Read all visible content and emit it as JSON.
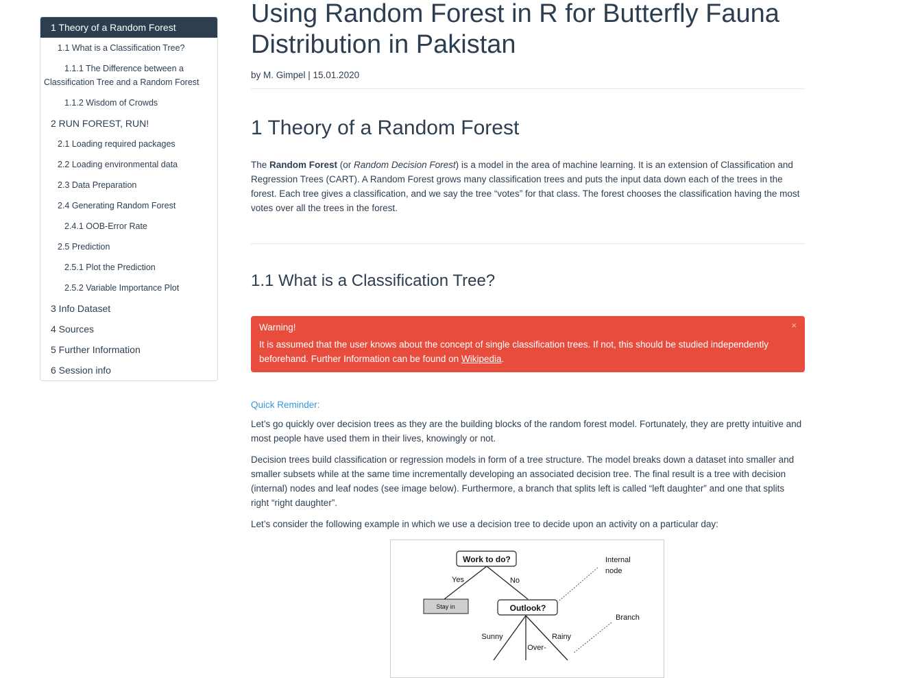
{
  "toc": [
    {
      "label": "1 Theory of a Random Forest",
      "level": 1,
      "active": true
    },
    {
      "label": "1.1 What is a Classification Tree?",
      "level": 2
    },
    {
      "label": "1.1.1 The Difference between a Classification Tree and a Random Forest",
      "level": 3
    },
    {
      "label": "1.1.2 Wisdom of Crowds",
      "level": 3
    },
    {
      "label": "2 RUN FOREST, RUN!",
      "level": 1
    },
    {
      "label": "2.1 Loading required packages",
      "level": 2
    },
    {
      "label": "2.2 Loading environmental data",
      "level": 2
    },
    {
      "label": "2.3 Data Preparation",
      "level": 2
    },
    {
      "label": "2.4 Generating Random Forest",
      "level": 2
    },
    {
      "label": "2.4.1 OOB-Error Rate",
      "level": 3
    },
    {
      "label": "2.5 Prediction",
      "level": 2
    },
    {
      "label": "2.5.1 Plot the Prediction",
      "level": 3
    },
    {
      "label": "2.5.2 Variable Importance Plot",
      "level": 3
    },
    {
      "label": "3 Info Dataset",
      "level": 1
    },
    {
      "label": "4 Sources",
      "level": 1
    },
    {
      "label": "5 Further Information",
      "level": 1
    },
    {
      "label": "6 Session info",
      "level": 1
    }
  ],
  "page": {
    "title": "Using Random Forest in R for Butterfly Fauna Distribution in Pakistan",
    "byline": "by M. Gimpel | 15.01.2020"
  },
  "section1": {
    "heading": "1 Theory of a Random Forest",
    "p_the": "The ",
    "p_bold": "Random Forest",
    "p_or": " (or ",
    "p_italic": "Random Decision Forest",
    "p_rest": ") is a model in the area of machine learning. It is an extension of Classification and Regression Trees (CART). A Random Forest grows many classification trees and puts the input data down each of the trees in the forest. Each tree gives a classification, and we say the tree “votes” for that class. The forest chooses the classification having the most votes over all the trees in the forest."
  },
  "section11": {
    "heading": "1.1 What is a Classification Tree?",
    "alert": {
      "title": "Warning!",
      "body": "It is assumed that the user knows about the concept of single classification trees. If not, this should be studied independently beforehand. Further Information can be found on ",
      "link": "Wikipedia",
      "end": ".",
      "close": "×"
    },
    "reminder": "Quick Reminder:",
    "p1": "Let’s go quickly over decision trees as they are the building blocks of the random forest model. Fortunately, they are pretty intuitive and most people have used them in their lives, knowingly or not.",
    "p2": "Decision trees build classification or regression models in form of a tree structure. The model breaks down a dataset into smaller and smaller subsets while at the same time incrementally developing an associated decision tree. The final result is a tree with decision (internal) nodes and leaf nodes (see image below). Furthermore, a branch that splits left is called “left daughter” and one that splits right “right daughter”.",
    "p3": "Let’s consider the following example in which we use a decision tree to decide upon an activity on a particular day:"
  },
  "figure": {
    "node_root": "Work to do?",
    "edge_yes": "Yes",
    "edge_no": "No",
    "leaf_stay": "Stay in",
    "node_outlook": "Outlook?",
    "edge_sunny": "Sunny",
    "edge_over": "Over-",
    "edge_rainy": "Rainy",
    "ann_internal_1": "Internal",
    "ann_internal_2": "node",
    "ann_branch": "Branch"
  }
}
